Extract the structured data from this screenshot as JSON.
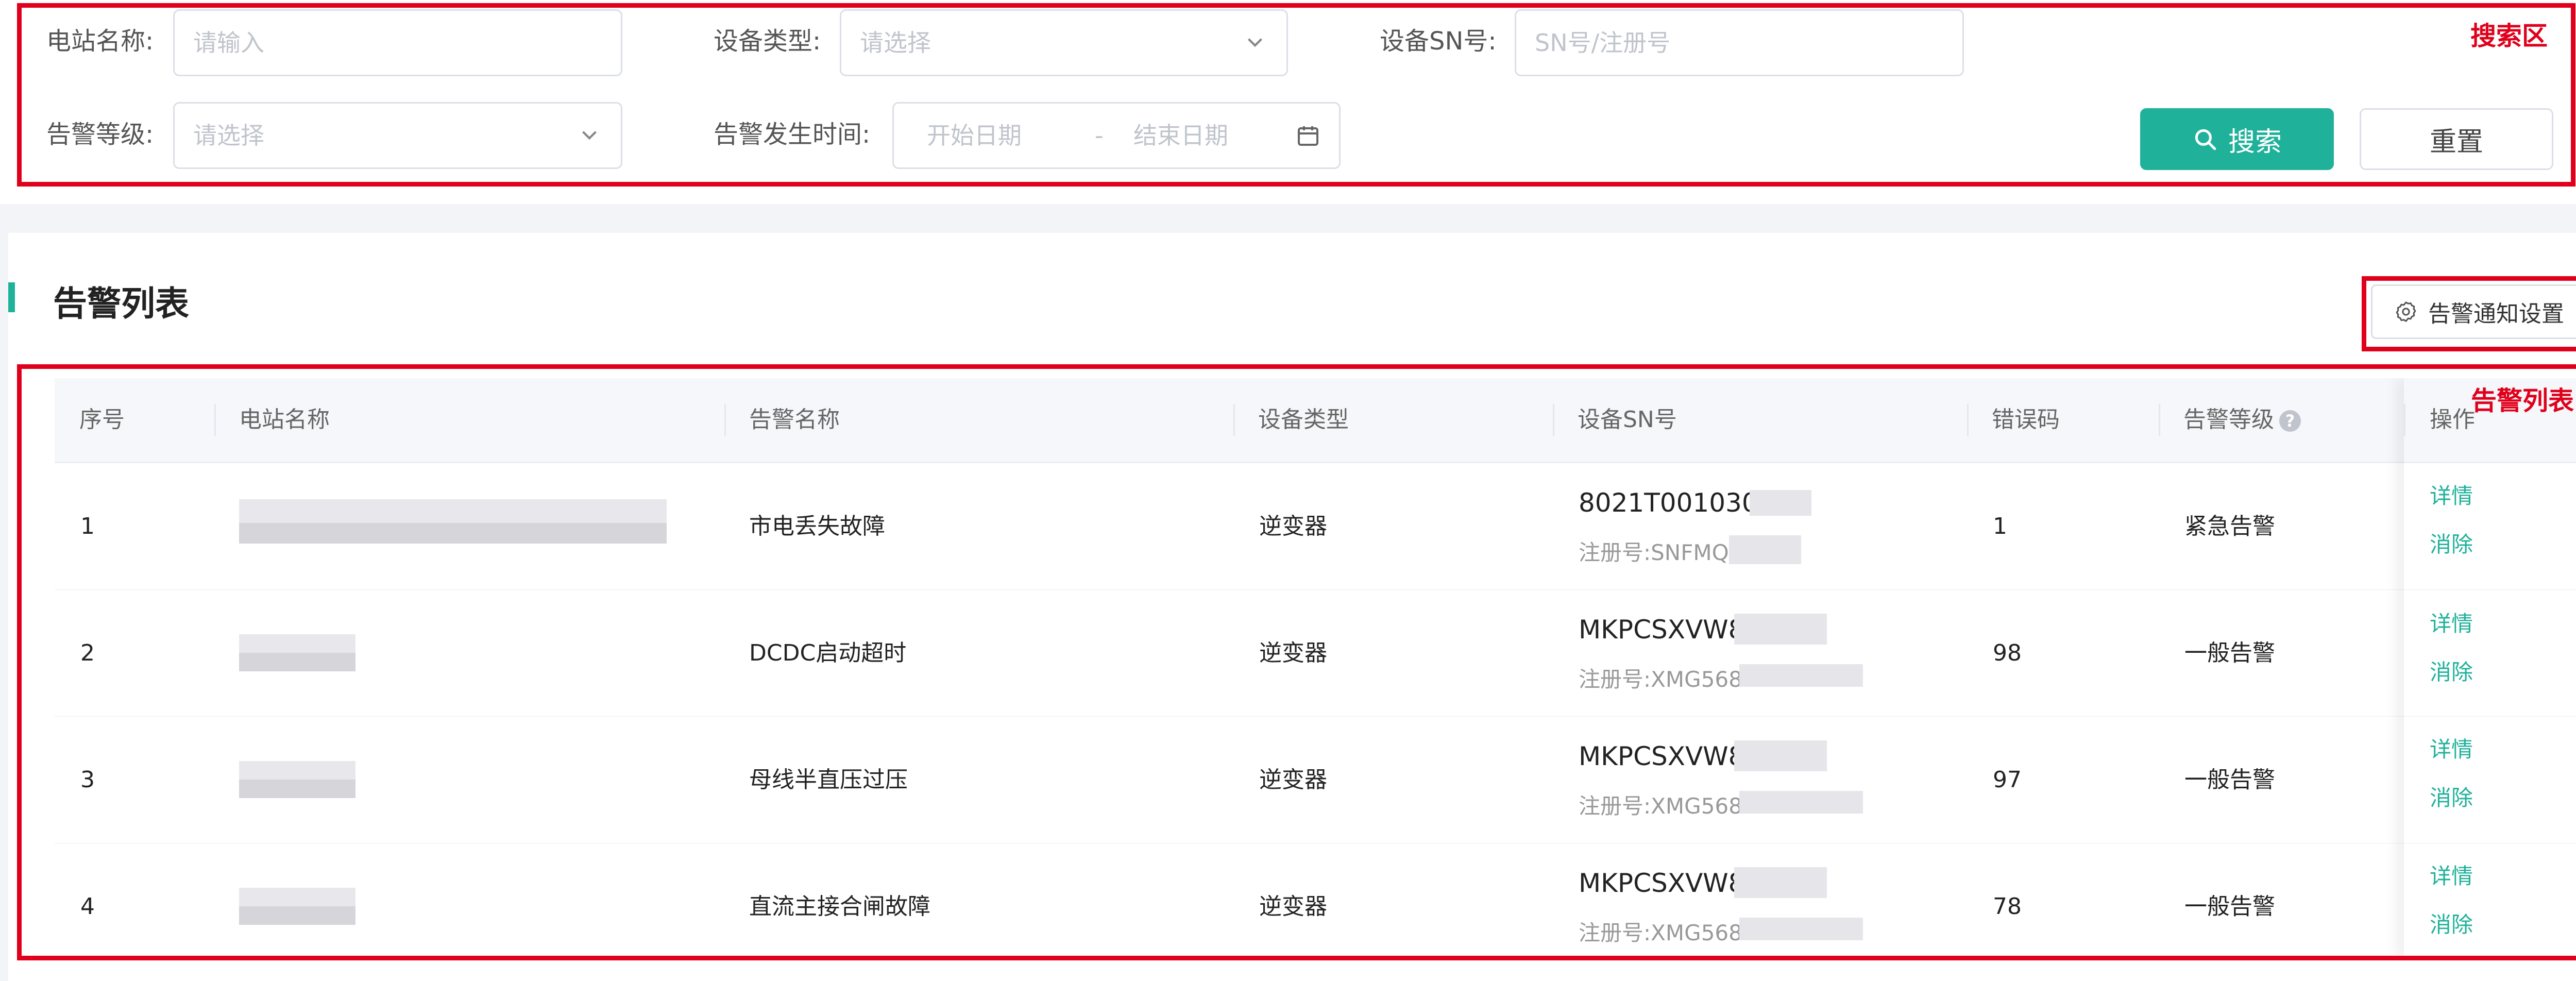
{
  "search": {
    "station_name_label": "电站名称:",
    "station_name_placeholder": "请输入",
    "device_type_label": "设备类型:",
    "device_type_placeholder": "请选择",
    "device_sn_label": "设备SN号:",
    "device_sn_placeholder": "SN号/注册号",
    "alarm_level_label": "告警等级:",
    "alarm_level_placeholder": "请选择",
    "alarm_time_label": "告警发生时间:",
    "start_date_placeholder": "开始日期",
    "date_separator": "-",
    "end_date_placeholder": "结束日期",
    "search_button": "搜索",
    "reset_button": "重置"
  },
  "annotations": {
    "search_area": "搜索区",
    "alarm_list": "告警列表"
  },
  "list": {
    "title": "告警列表",
    "notify_settings_button": "告警通知设置",
    "columns": [
      "序号",
      "电站名称",
      "告警名称",
      "设备类型",
      "设备SN号",
      "错误码",
      "告警等级",
      "操作"
    ],
    "rows": [
      {
        "index": "1",
        "alarm_name": "市电丢失故障",
        "device_type": "逆变器",
        "sn": "8021T0010301",
        "reg": "注册号:SNFMQVT",
        "error_code": "1",
        "level": "紧急告警",
        "detail": "详情",
        "clear": "消除"
      },
      {
        "index": "2",
        "alarm_name": "DCDC启动超时",
        "device_type": "逆变器",
        "sn": "MKPCSXVW81",
        "reg": "注册号:XMG5687",
        "error_code": "98",
        "level": "一般告警",
        "detail": "详情",
        "clear": "消除"
      },
      {
        "index": "3",
        "alarm_name": "母线半直压过压",
        "device_type": "逆变器",
        "sn": "MKPCSXVW81",
        "reg": "注册号:XMG5687",
        "error_code": "97",
        "level": "一般告警",
        "detail": "详情",
        "clear": "消除"
      },
      {
        "index": "4",
        "alarm_name": "直流主接合闸故障",
        "device_type": "逆变器",
        "sn": "MKPCSXVW81",
        "reg": "注册号:XMG5687",
        "error_code": "78",
        "level": "一般告警",
        "detail": "详情",
        "clear": "消除"
      }
    ]
  },
  "icons": {
    "search": "search-icon",
    "dropdown": "chevron-down-icon",
    "calendar": "calendar-icon",
    "settings": "gear-icon",
    "help": "help-icon"
  },
  "colors": {
    "accent": "#1fb19a",
    "annotation_red": "#e0001b",
    "link": "#1fb19a"
  }
}
